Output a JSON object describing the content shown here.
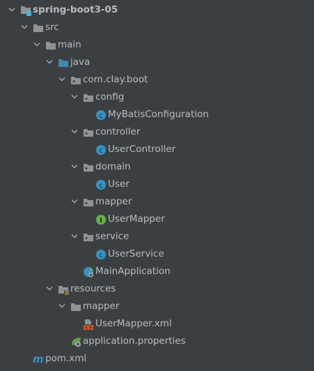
{
  "colors": {
    "background": "#3c3f41",
    "text": "#bbbbbb",
    "folder": "#8c9499",
    "source_folder": "#3d8aa8",
    "class": "#3592c4",
    "interface": "#62b543",
    "xml": "#c75826",
    "maven": "#3592c4",
    "spring": "#5fa044"
  },
  "tree": [
    {
      "label": "spring-boot3-05",
      "depth": 0,
      "expanded": true,
      "icon": "module-icon",
      "bold": true
    },
    {
      "label": "src",
      "depth": 1,
      "expanded": true,
      "icon": "folder-icon"
    },
    {
      "label": "main",
      "depth": 2,
      "expanded": true,
      "icon": "folder-icon"
    },
    {
      "label": "java",
      "depth": 3,
      "expanded": true,
      "icon": "source-folder-icon"
    },
    {
      "label": "com.clay.boot",
      "depth": 4,
      "expanded": true,
      "icon": "package-icon"
    },
    {
      "label": "config",
      "depth": 5,
      "expanded": true,
      "icon": "package-icon"
    },
    {
      "label": "MyBatisConfiguration",
      "depth": 6,
      "icon": "class-icon"
    },
    {
      "label": "controller",
      "depth": 5,
      "expanded": true,
      "icon": "package-icon"
    },
    {
      "label": "UserController",
      "depth": 6,
      "icon": "class-icon"
    },
    {
      "label": "domain",
      "depth": 5,
      "expanded": true,
      "icon": "package-icon"
    },
    {
      "label": "User",
      "depth": 6,
      "icon": "class-icon"
    },
    {
      "label": "mapper",
      "depth": 5,
      "expanded": true,
      "icon": "package-icon"
    },
    {
      "label": "UserMapper",
      "depth": 6,
      "icon": "interface-icon"
    },
    {
      "label": "service",
      "depth": 5,
      "expanded": true,
      "icon": "package-icon"
    },
    {
      "label": "UserService",
      "depth": 6,
      "icon": "class-icon"
    },
    {
      "label": "MainApplication",
      "depth": 5,
      "icon": "spring-boot-app-icon"
    },
    {
      "label": "resources",
      "depth": 3,
      "expanded": true,
      "icon": "resources-folder-icon"
    },
    {
      "label": "mapper",
      "depth": 4,
      "expanded": true,
      "icon": "folder-icon"
    },
    {
      "label": "UserMapper.xml",
      "depth": 5,
      "icon": "xml-file-icon"
    },
    {
      "label": "application.properties",
      "depth": 4,
      "icon": "spring-properties-icon"
    },
    {
      "label": "pom.xml",
      "depth": 1,
      "icon": "maven-icon"
    }
  ]
}
